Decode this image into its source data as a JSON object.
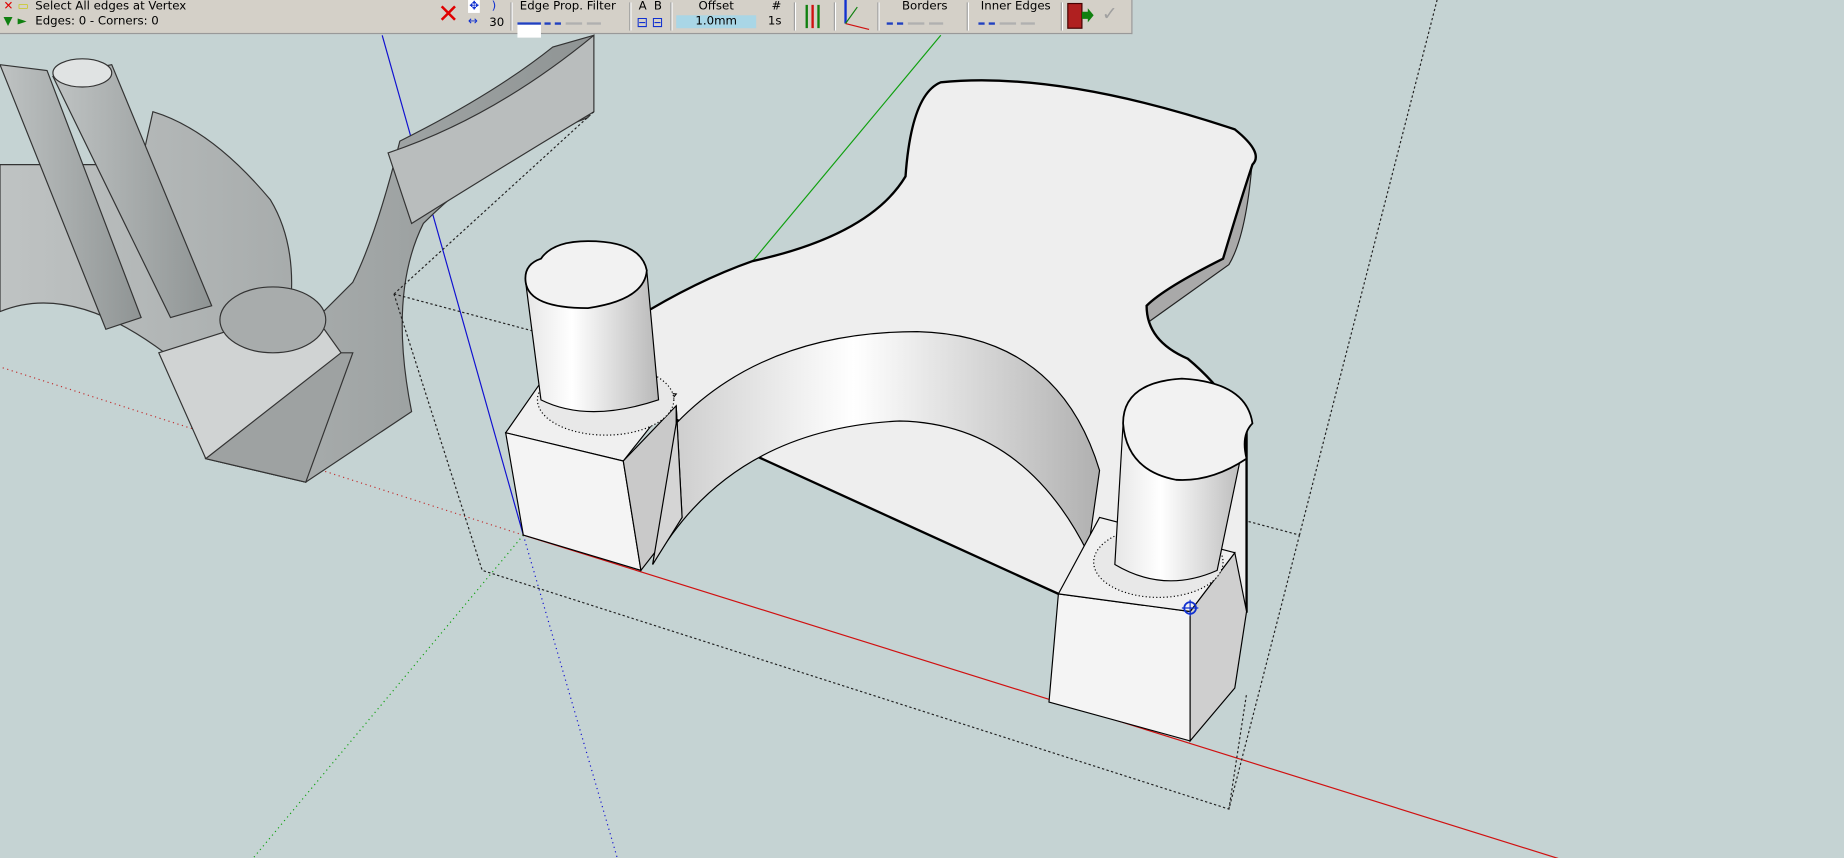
{
  "toolbar": {
    "title": "Select All edges at Vertex",
    "status": "Edges: 0 - Corners: 0",
    "angle_value": "30",
    "edge_prop_filter_label": "Edge Prop. Filter",
    "a_label": "A",
    "b_label": "B",
    "offset_label": "Offset",
    "offset_value": "1.0mm",
    "count_label": "#",
    "count_value": "1s",
    "borders_label": "Borders",
    "inner_edges_label": "Inner Edges"
  },
  "colors": {
    "background": "#c5d3d3",
    "model_face": "#eeeeee",
    "x_axis": "#d01010",
    "y_axis": "#10a010",
    "z_axis": "#1010d0"
  }
}
